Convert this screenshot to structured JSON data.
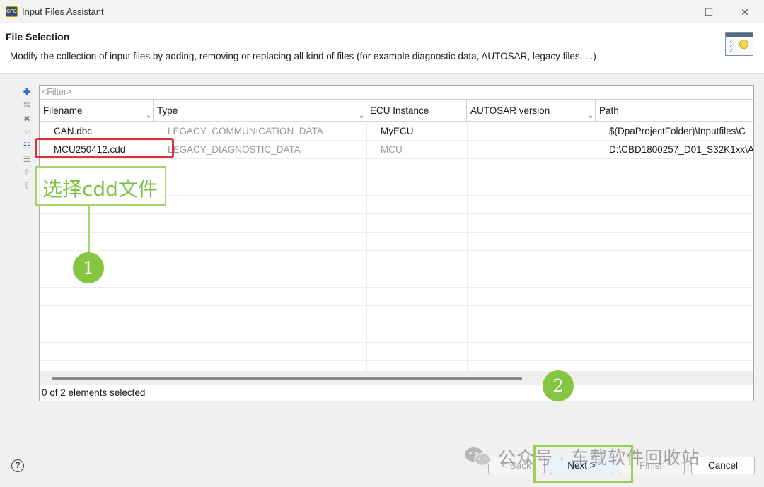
{
  "window": {
    "title": "Input Files Assistant",
    "app_icon_text": "CFG"
  },
  "header": {
    "title": "File Selection",
    "description": "Modify the collection of input files by adding, removing or replacing all kind of files (for example diagnostic data, AUTOSAR, legacy files, ...)"
  },
  "table": {
    "filter_placeholder": "<Filter>",
    "columns": [
      "Filename",
      "Type",
      "ECU Instance",
      "AUTOSAR version",
      "Path"
    ],
    "rows": [
      {
        "filename": "CAN.dbc",
        "type": "LEGACY_COMMUNICATION_DATA",
        "ecu": "MyECU",
        "autosar": "",
        "path": "$(DpaProjectFolder)\\Inputfiles\\C"
      },
      {
        "filename": "MCU250412.cdd",
        "type": "LEGACY_DIAGNOSTIC_DATA",
        "ecu": "MCU",
        "autosar": "",
        "path": "D:\\CBD1800257_D01_S32K1xx\\A"
      }
    ],
    "status": "0 of 2 elements selected"
  },
  "buttons": {
    "back": "< Back",
    "next": "Next >",
    "finish": "Finish",
    "cancel": "Cancel",
    "help": "?"
  },
  "annotations": {
    "callout_text": "选择cdd文件",
    "marker_1": "1",
    "marker_2": "2",
    "watermark": "公众号 · 车载软件回收站"
  },
  "colors": {
    "highlight_red": "#e0303a",
    "annotation_green": "#86c541"
  }
}
